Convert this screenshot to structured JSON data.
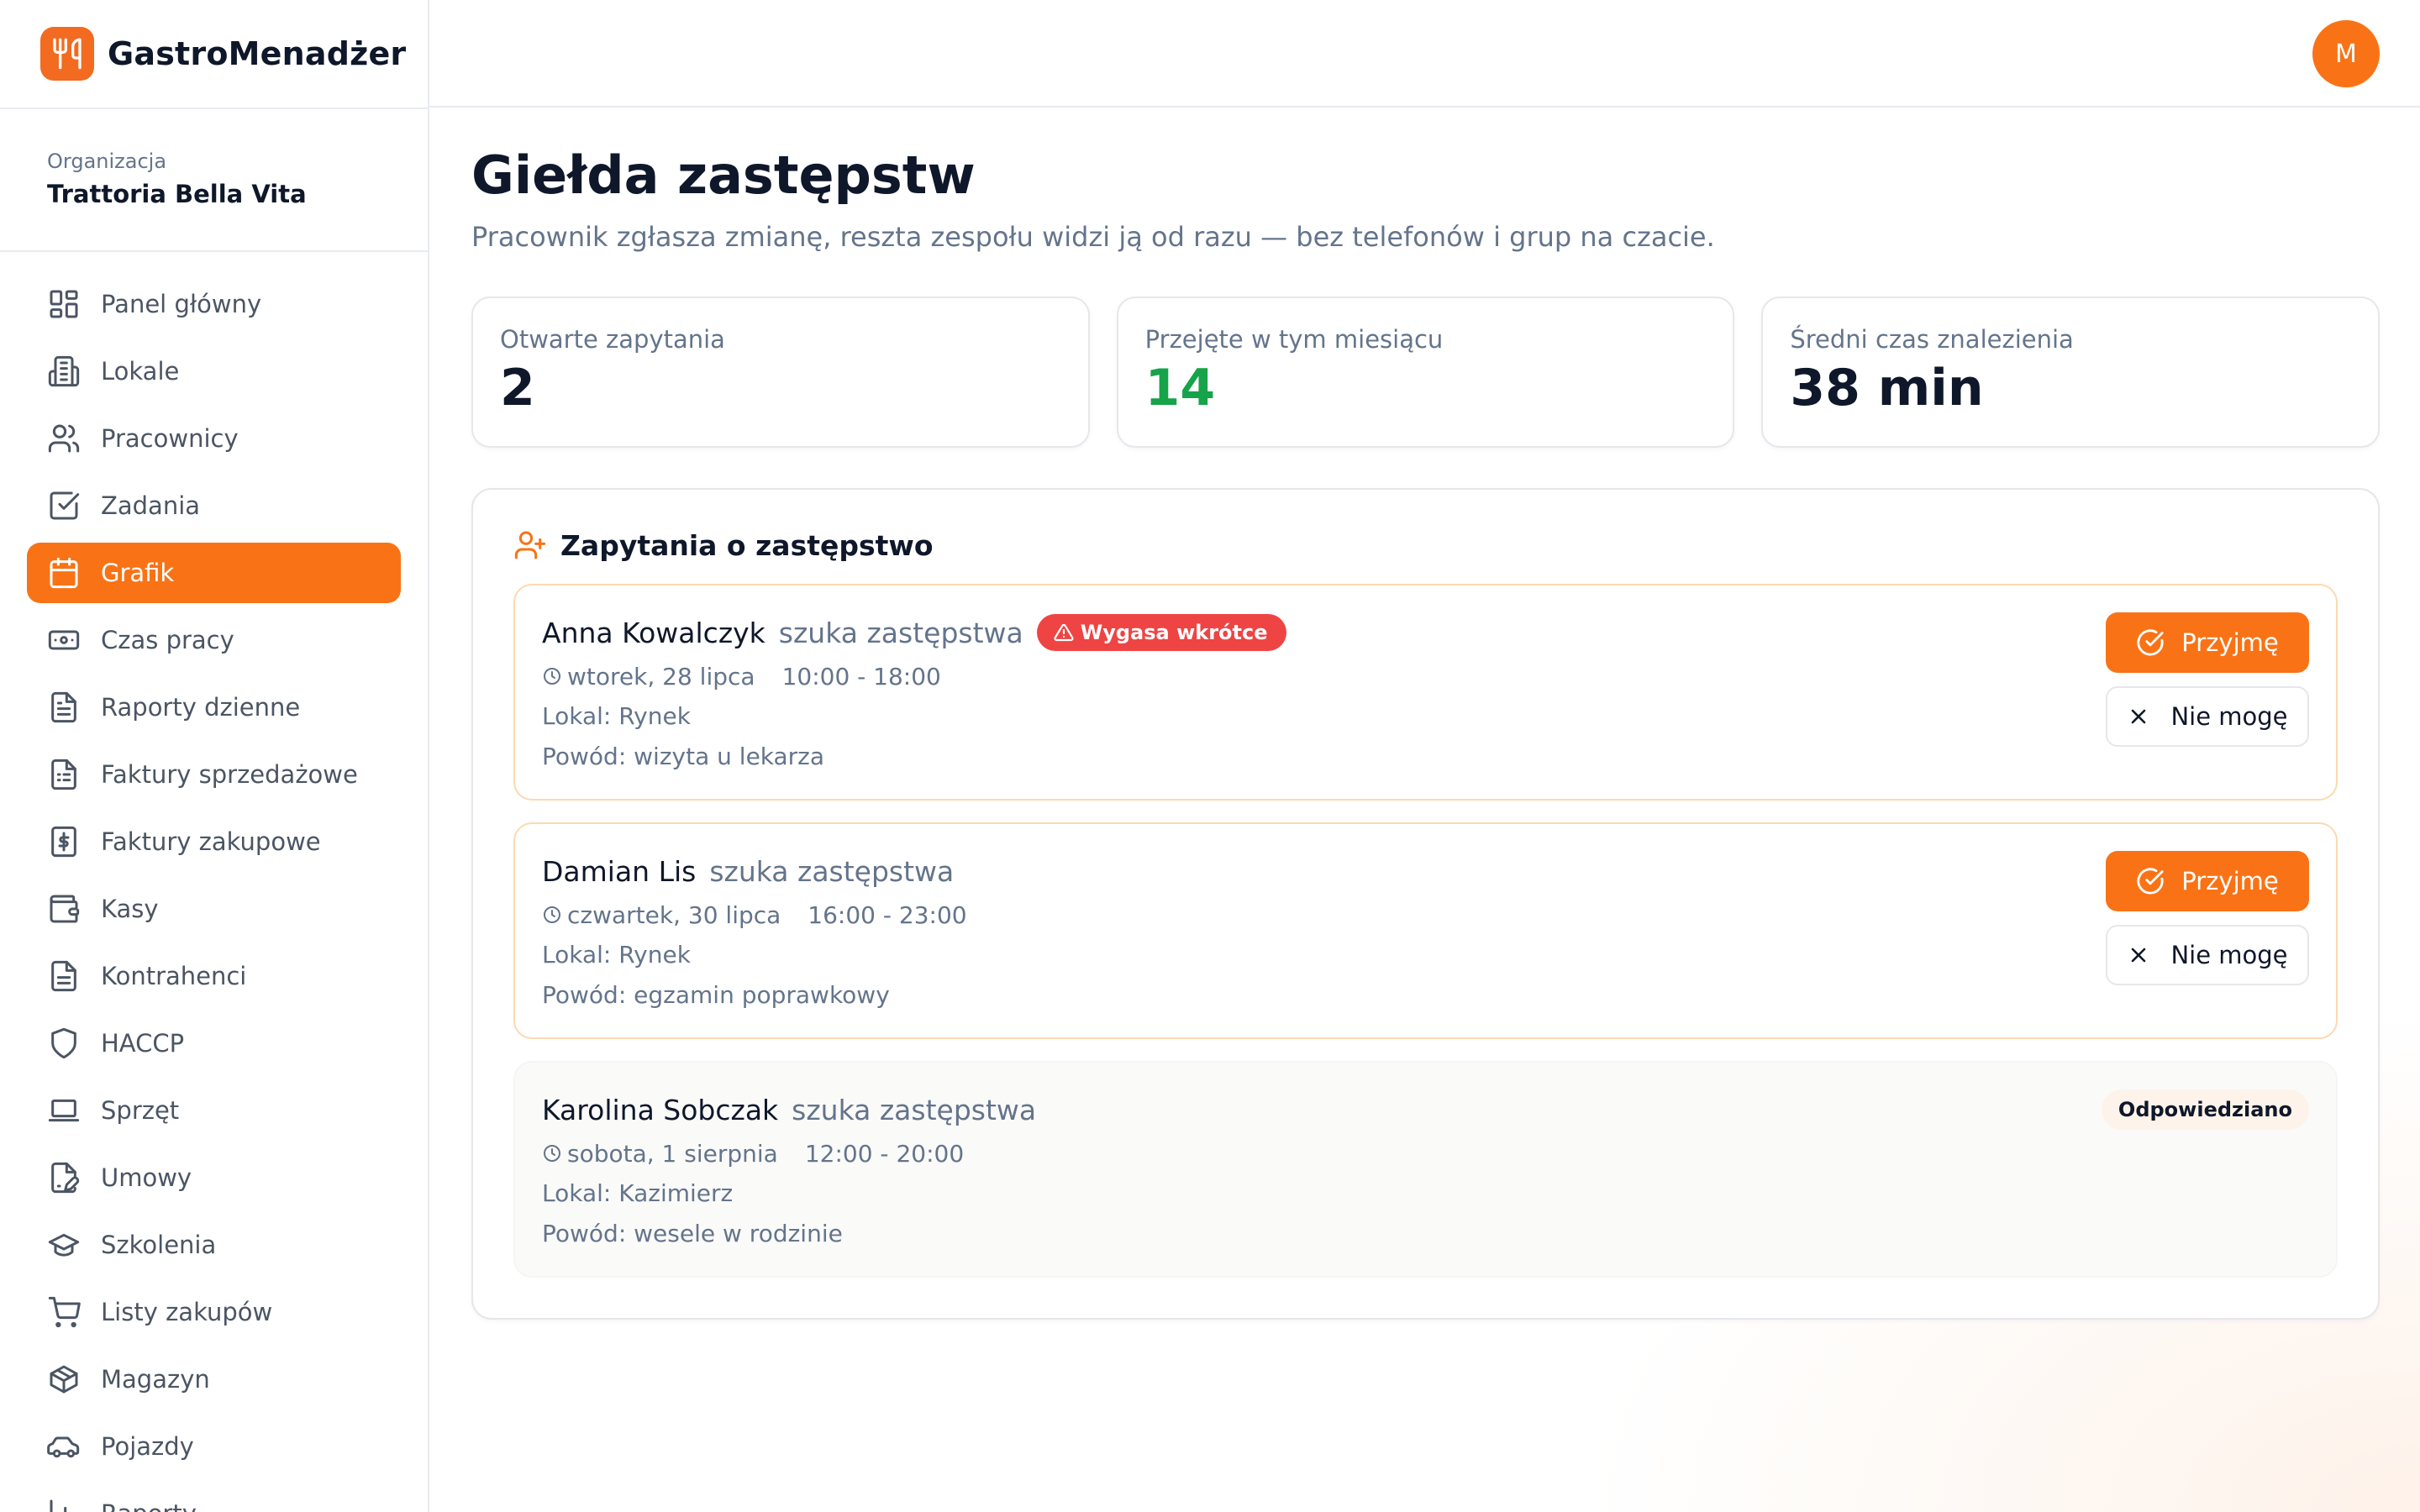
{
  "app": {
    "name": "GastroMenadżer",
    "user_initial": "M",
    "accent": "#f97316"
  },
  "organization": {
    "label": "Organizacja",
    "name": "Trattoria Bella Vita"
  },
  "sidebar": {
    "items": [
      {
        "label": "Panel główny",
        "icon": "dashboard-icon"
      },
      {
        "label": "Lokale",
        "icon": "building-icon"
      },
      {
        "label": "Pracownicy",
        "icon": "users-icon"
      },
      {
        "label": "Zadania",
        "icon": "checkbox-icon"
      },
      {
        "label": "Grafik",
        "icon": "calendar-icon",
        "active": true
      },
      {
        "label": "Czas pracy",
        "icon": "banknote-icon"
      },
      {
        "label": "Raporty dzienne",
        "icon": "report-icon"
      },
      {
        "label": "Faktury sprzedażowe",
        "icon": "invoice-icon"
      },
      {
        "label": "Faktury zakupowe",
        "icon": "dollar-file-icon"
      },
      {
        "label": "Kasy",
        "icon": "wallet-icon"
      },
      {
        "label": "Kontrahenci",
        "icon": "document-icon"
      },
      {
        "label": "HACCP",
        "icon": "shield-icon"
      },
      {
        "label": "Sprzęt",
        "icon": "laptop-icon"
      },
      {
        "label": "Umowy",
        "icon": "file-signature-icon"
      },
      {
        "label": "Szkolenia",
        "icon": "graduation-cap-icon"
      },
      {
        "label": "Listy zakupów",
        "icon": "cart-icon"
      },
      {
        "label": "Magazyn",
        "icon": "package-icon"
      },
      {
        "label": "Pojazdy",
        "icon": "car-icon"
      },
      {
        "label": "Raporty",
        "icon": "chart-icon"
      }
    ]
  },
  "page": {
    "title": "Giełda zastępstw",
    "subtitle": "Pracownik zgłasza zmianę, reszta zespołu widzi ją od razu — bez telefonów i grup na czacie."
  },
  "stats": [
    {
      "label": "Otwarte zapytania",
      "value": "2"
    },
    {
      "label": "Przejęte w tym miesiącu",
      "value": "14",
      "color": "#16a34a"
    },
    {
      "label": "Średni czas znalezienia",
      "value": "38 min"
    }
  ],
  "panel": {
    "title": "Zapytania o zastępstwo",
    "accept_label": "Przyjmę",
    "decline_label": "Nie mogę",
    "requests": [
      {
        "name": "Anna Kowalczyk",
        "seeks": "szuka zastępstwa",
        "badge": "Wygasa wkrótce",
        "date": "wtorek, 28 lipca",
        "time": "10:00 - 18:00",
        "location": "Lokal: Rynek",
        "reason": "Powód: wizyta u lekarza"
      },
      {
        "name": "Damian Lis",
        "seeks": "szuka zastępstwa",
        "date": "czwartek, 30 lipca",
        "time": "16:00 - 23:00",
        "location": "Lokal: Rynek",
        "reason": "Powód: egzamin poprawkowy"
      },
      {
        "name": "Karolina Sobczak",
        "seeks": "szuka zastępstwa",
        "status": "Odpowiedziano",
        "date": "sobota, 1 sierpnia",
        "time": "12:00 - 20:00",
        "location": "Lokal: Kazimierz",
        "reason": "Powód: wesele w rodzinie"
      }
    ]
  }
}
